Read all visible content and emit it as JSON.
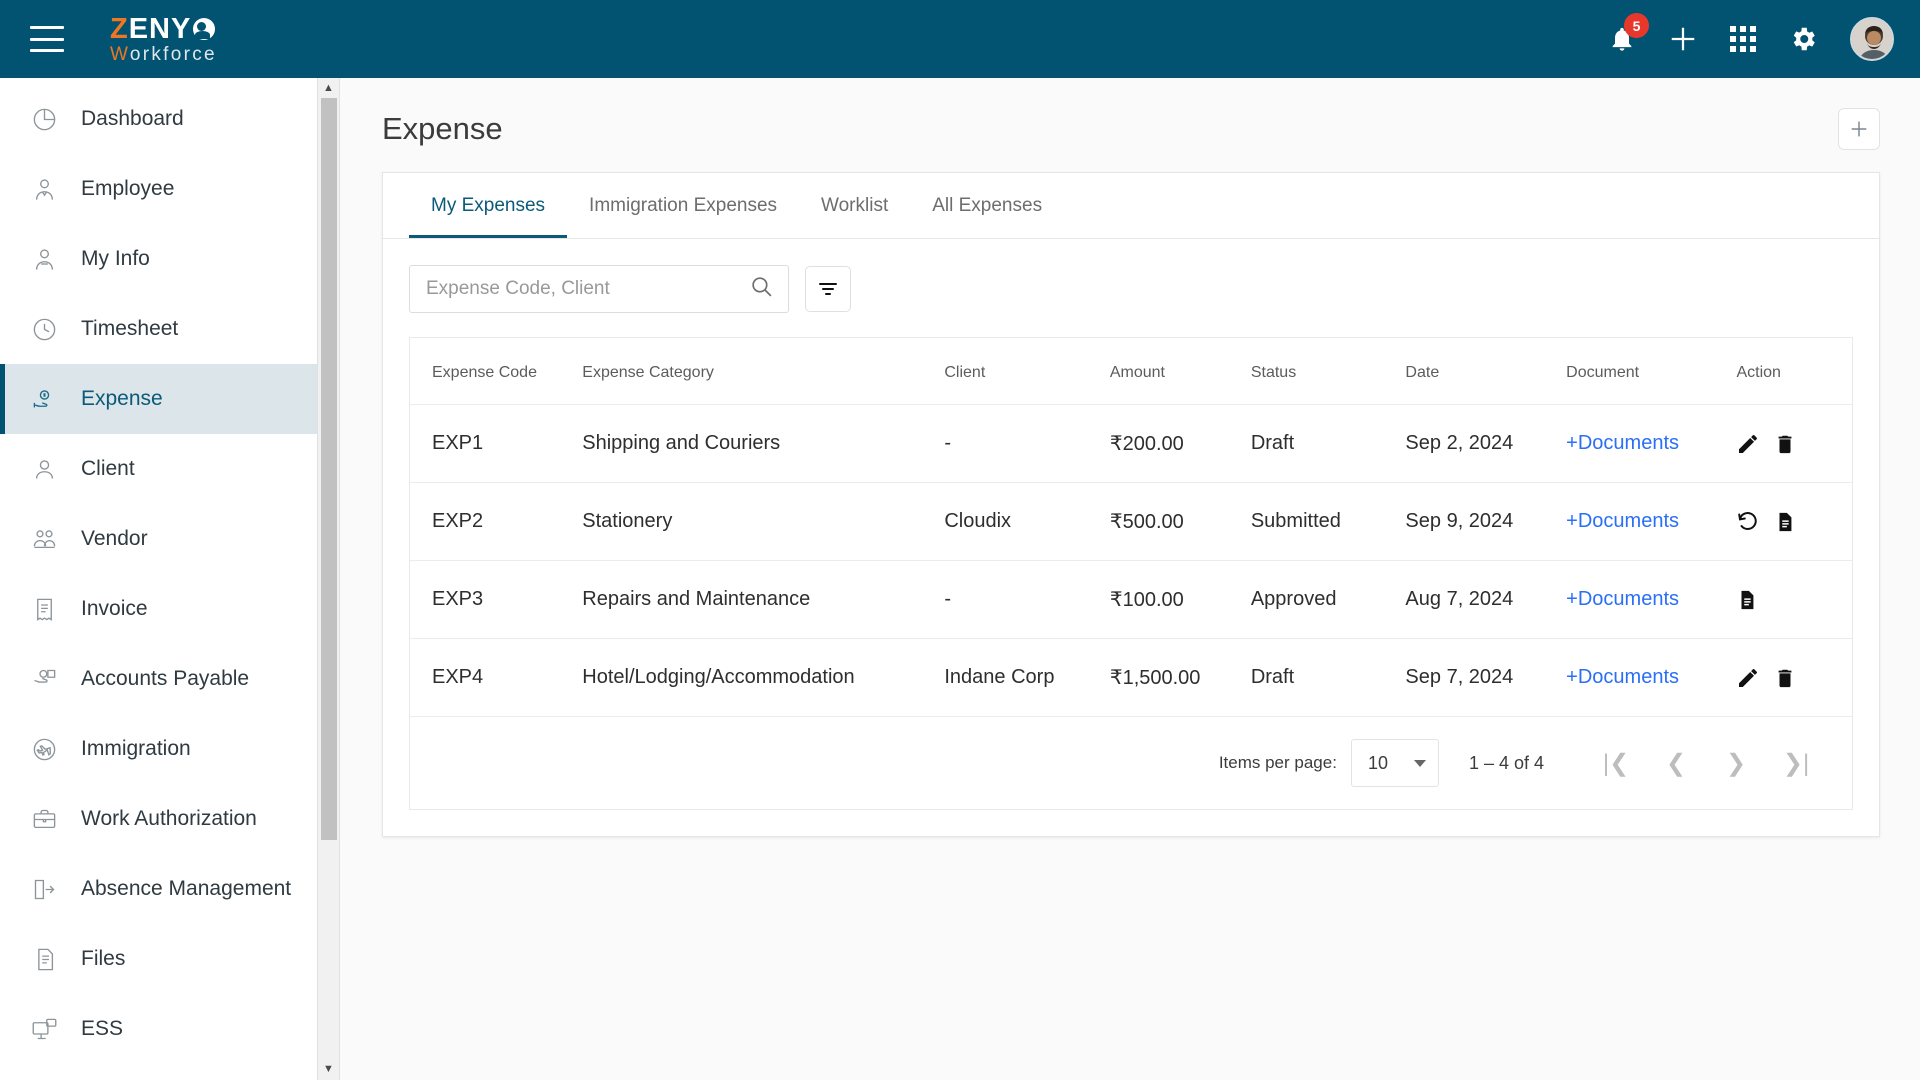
{
  "brand": {
    "name_top_accent": "Z",
    "name_top_rest": "ENY",
    "name_bottom_accent": "W",
    "name_bottom_rest": "orkforce",
    "accent_color": "#ef7622",
    "header_color": "#015371"
  },
  "topbar": {
    "menu_icon": "hamburger-icon",
    "notification_icon": "bell-icon",
    "notification_count": "5",
    "add_icon": "plus-icon",
    "apps_icon": "grid-apps-icon",
    "settings_icon": "gear-icon",
    "avatar_icon": "user-avatar"
  },
  "sidebar": {
    "items": [
      {
        "label": "Dashboard",
        "icon": "pie-chart-icon",
        "active": false
      },
      {
        "label": "Employee",
        "icon": "employee-icon",
        "active": false
      },
      {
        "label": "My Info",
        "icon": "person-info-icon",
        "active": false
      },
      {
        "label": "Timesheet",
        "icon": "clock-icon",
        "active": false
      },
      {
        "label": "Expense",
        "icon": "money-hand-icon",
        "active": true
      },
      {
        "label": "Client",
        "icon": "person-icon",
        "active": false
      },
      {
        "label": "Vendor",
        "icon": "vendor-icon",
        "active": false
      },
      {
        "label": "Invoice",
        "icon": "invoice-icon",
        "active": false
      },
      {
        "label": "Accounts Payable",
        "icon": "accounts-payable-icon",
        "active": false
      },
      {
        "label": "Immigration",
        "icon": "airplane-icon",
        "active": false
      },
      {
        "label": "Work Authorization",
        "icon": "briefcase-icon",
        "active": false
      },
      {
        "label": "Absence Management",
        "icon": "exit-door-icon",
        "active": false
      },
      {
        "label": "Files",
        "icon": "files-icon",
        "active": false
      },
      {
        "label": "ESS",
        "icon": "ess-monitor-icon",
        "active": false
      }
    ],
    "scroll_up_glyph": "▲",
    "scroll_down_glyph": "▼"
  },
  "page": {
    "title": "Expense",
    "add_button_label": "+"
  },
  "tabs": [
    {
      "label": "My Expenses",
      "active": true
    },
    {
      "label": "Immigration Expenses",
      "active": false
    },
    {
      "label": "Worklist",
      "active": false
    },
    {
      "label": "All Expenses",
      "active": false
    }
  ],
  "search": {
    "placeholder": "Expense Code, Client",
    "value": "",
    "icon": "search-icon",
    "filter_icon": "filter-icon"
  },
  "table": {
    "columns": [
      "Expense Code",
      "Expense Category",
      "Client",
      "Amount",
      "Status",
      "Date",
      "Document",
      "Action"
    ],
    "document_link_label": "+Documents",
    "document_link_color": "#2a6ff5",
    "rows": [
      {
        "code": "EXP1",
        "category": "Shipping and Couriers",
        "client": "-",
        "amount": "₹200.00",
        "status": "Draft",
        "date": "Sep 2, 2024",
        "document": "+Documents",
        "actions": [
          "edit-icon",
          "delete-icon"
        ]
      },
      {
        "code": "EXP2",
        "category": "Stationery",
        "client": "Cloudix",
        "amount": "₹500.00",
        "status": "Submitted",
        "date": "Sep 9, 2024",
        "document": "+Documents",
        "actions": [
          "revert-icon",
          "document-icon"
        ]
      },
      {
        "code": "EXP3",
        "category": "Repairs and Maintenance",
        "client": "-",
        "amount": "₹100.00",
        "status": "Approved",
        "date": "Aug 7, 2024",
        "document": "+Documents",
        "actions": [
          "document-icon"
        ]
      },
      {
        "code": "EXP4",
        "category": "Hotel/Lodging/Accommodation",
        "client": "Indane Corp",
        "amount": "₹1,500.00",
        "status": "Draft",
        "date": "Sep 7, 2024",
        "document": "+Documents",
        "actions": [
          "edit-icon",
          "delete-icon"
        ]
      }
    ]
  },
  "paginator": {
    "items_per_page_label": "Items per page:",
    "items_per_page_value": "10",
    "range_label": "1 – 4 of 4",
    "first_glyph": "|❮",
    "prev_glyph": "❮",
    "next_glyph": "❯",
    "last_glyph": "❯|"
  }
}
